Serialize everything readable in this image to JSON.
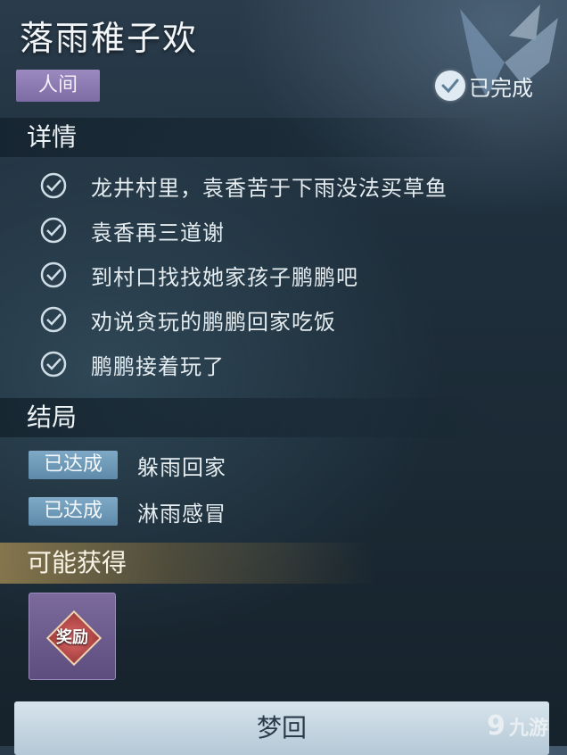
{
  "quest": {
    "title": "落雨稚子欢",
    "tag": "人间",
    "status": "已完成"
  },
  "details": {
    "heading": "详情",
    "items": [
      "龙井村里，袁香苦于下雨没法买草鱼",
      "袁香再三道谢",
      "到村口找找她家孩子鹏鹏吧",
      "劝说贪玩的鹏鹏回家吃饭",
      "鹏鹏接着玩了"
    ]
  },
  "endings": {
    "heading": "结局",
    "items": [
      {
        "badge": "已达成",
        "label": "躲雨回家"
      },
      {
        "badge": "已达成",
        "label": "淋雨感冒"
      }
    ]
  },
  "rewards": {
    "heading": "可能获得",
    "item_label": "奖励"
  },
  "action": {
    "button_label": "梦回"
  },
  "watermark": {
    "logo": "9",
    "text": "九游"
  },
  "icons": [
    "check-circle-icon",
    "reward-mystery-icon",
    "butterfly-decoration"
  ]
}
